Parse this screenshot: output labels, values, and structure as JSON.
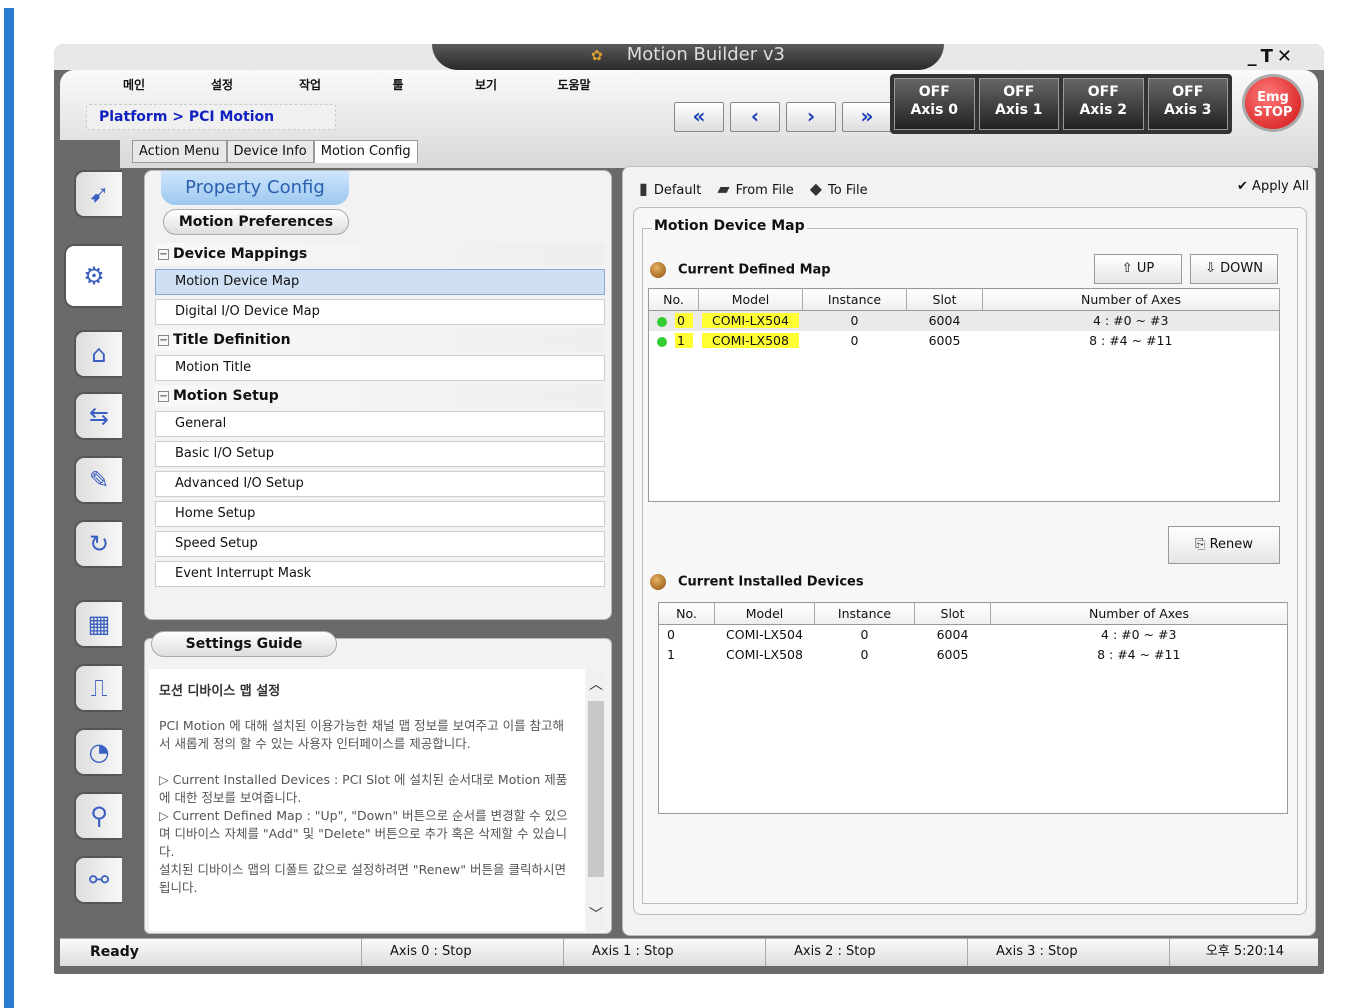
{
  "window": {
    "title": "Motion Builder v3",
    "controls": "_T✕"
  },
  "menu": [
    "메인",
    "설정",
    "작업",
    "툴",
    "보기",
    "도움말"
  ],
  "breadcrumb": "Platform > PCI Motion",
  "nav": [
    "«",
    "‹",
    "›",
    "»"
  ],
  "axes": [
    {
      "state": "OFF",
      "label": "Axis 0"
    },
    {
      "state": "OFF",
      "label": "Axis 1"
    },
    {
      "state": "OFF",
      "label": "Axis 2"
    },
    {
      "state": "OFF",
      "label": "Axis 3"
    }
  ],
  "emg": {
    "line1": "Emg",
    "line2": "STOP"
  },
  "tabs": [
    "Action Menu",
    "Device Info",
    "Motion Config"
  ],
  "left": {
    "header": "Property Config",
    "prefs": "Motion Preferences",
    "groups": [
      {
        "name": "Device Mappings",
        "items": [
          "Motion Device Map",
          "Digital I/O Device Map"
        ]
      },
      {
        "name": "Title Definition",
        "items": [
          "Motion Title"
        ]
      },
      {
        "name": "Motion Setup",
        "items": [
          "General",
          "Basic I/O Setup",
          "Advanced I/O Setup",
          "Home Setup",
          "Speed Setup",
          "Event Interrupt Mask"
        ]
      }
    ]
  },
  "guide": {
    "title": "Settings Guide",
    "heading": "모션 디바이스 맵 설정",
    "p1": "PCI Motion 에 대해 설치된 이용가능한 채널 맵 정보를 보여주고 이를 참고해서 새롭게 정의 할 수 있는 사용자 인터페이스를 제공합니다.",
    "p2": "▷ Current Installed Devices : PCI Slot 에 설치된 순서대로 Motion 제품에 대한 정보를 보여줍니다.",
    "p3": "▷ Current Defined Map : \"Up\", \"Down\" 버튼으로 순서를 변경할 수 있으며 디바이스 자체를 \"Add\" 및 \"Delete\" 버튼으로 추가 혹은 삭제할 수 있습니다.",
    "p4": "설치된 디바이스 맵의 디폴트 값으로 설정하려면 \"Renew\" 버튼을 클릭하시면 됩니다."
  },
  "toolbar": {
    "default": "Default",
    "from_file": "From File",
    "to_file": "To File",
    "apply_all": "Apply All"
  },
  "map": {
    "title": "Motion Device Map",
    "defined_title": "Current Defined Map",
    "up": "UP",
    "down": "DOWN",
    "renew": "Renew",
    "installed_title": "Current Installed Devices",
    "columns": [
      "No.",
      "Model",
      "Instance",
      "Slot",
      "Number of Axes"
    ],
    "defined": [
      {
        "no": "0",
        "model": "COMI-LX504",
        "instance": "0",
        "slot": "6004",
        "axes": "4 : #0 ~ #3"
      },
      {
        "no": "1",
        "model": "COMI-LX508",
        "instance": "0",
        "slot": "6005",
        "axes": "8 : #4 ~ #11"
      }
    ],
    "installed": [
      {
        "no": "0",
        "model": "COMI-LX504",
        "instance": "0",
        "slot": "6004",
        "axes": "4 : #0 ~ #3"
      },
      {
        "no": "1",
        "model": "COMI-LX508",
        "instance": "0",
        "slot": "6005",
        "axes": "8 : #4 ~ #11"
      }
    ]
  },
  "status": {
    "ready": "Ready",
    "a0": "Axis 0 :  Stop",
    "a1": "Axis 1 :  Stop",
    "a2": "Axis 2 :  Stop",
    "a3": "Axis 3 :  Stop",
    "time": "오후 5:20:14"
  }
}
